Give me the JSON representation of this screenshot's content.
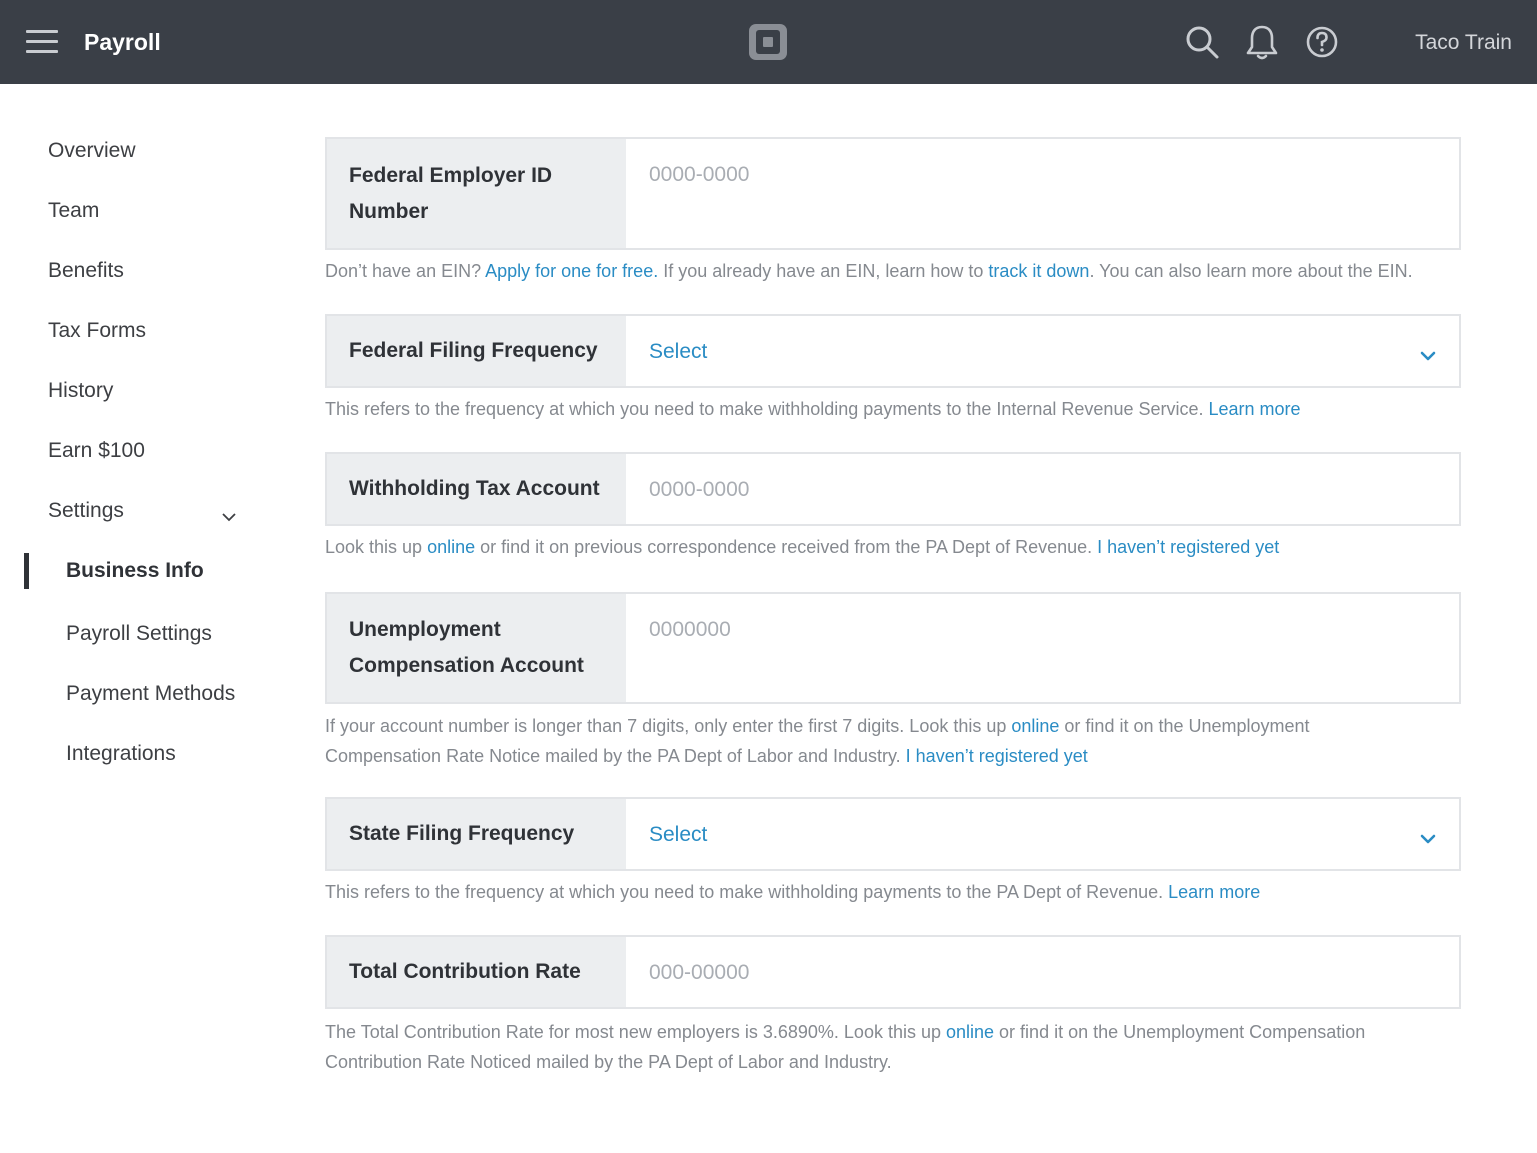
{
  "header": {
    "title": "Payroll",
    "account": "Taco Train"
  },
  "sidebar": {
    "items": [
      "Overview",
      "Team",
      "Benefits",
      "Tax Forms",
      "History",
      "Earn $100",
      "Settings"
    ],
    "sub_items": [
      "Business Info",
      "Payroll Settings",
      "Payment Methods",
      "Integrations"
    ],
    "active": "Business Info"
  },
  "form": {
    "ein": {
      "label": "Federal Employer ID Number",
      "placeholder": "0000-0000",
      "help_1": "Don’t have an EIN? ",
      "help_link_1": "Apply for one for free.",
      "help_2": " If you already have an EIN, learn how to ",
      "help_link_2": "track it down",
      "help_3": ". You can also learn more about the EIN."
    },
    "federal_frequency": {
      "label": "Federal Filing Frequency",
      "value": "Select",
      "help_1": "This refers to the frequency at which you need to make withholding payments to the Internal Revenue Service. ",
      "help_link": "Learn more"
    },
    "withholding": {
      "label": "Withholding Tax Account",
      "placeholder": "0000-0000",
      "help_1": "Look this up ",
      "help_link_1": "online",
      "help_2": " or find it on previous correspondence received from the PA Dept of Revenue. ",
      "help_link_2": "I haven’t registered yet"
    },
    "unemployment": {
      "label": "Unemployment Compensation Account",
      "placeholder": "0000000",
      "help_1": "If your account number is longer than 7 digits, only enter the first 7 digits. Look this up ",
      "help_link_1": "online",
      "help_2": " or find it on the Unemployment Compensation Rate Notice mailed by the PA Dept of Labor and Industry. ",
      "help_link_2": "I haven’t registered yet"
    },
    "state_frequency": {
      "label": "State Filing Frequency",
      "value": "Select",
      "help_1": "This refers to the frequency at which you need to make withholding payments to the PA Dept of Revenue. ",
      "help_link": "Learn more"
    },
    "contribution": {
      "label": "Total Contribution Rate",
      "placeholder": "000-00000",
      "help_1": "The Total Contribution Rate for most new employers is 3.6890%. Look this up ",
      "help_link": "online",
      "help_2": " or find it on the Unemployment Compensation Contribution Rate Noticed mailed by the PA Dept of Labor and Industry."
    }
  },
  "colors": {
    "topbar": "#3a3f47",
    "link": "#2a8cc4",
    "label_bg": "#eceef0"
  },
  "icons": [
    "menu-icon",
    "square-logo-icon",
    "search-icon",
    "bell-icon",
    "help-icon",
    "chevron-down-icon"
  ]
}
